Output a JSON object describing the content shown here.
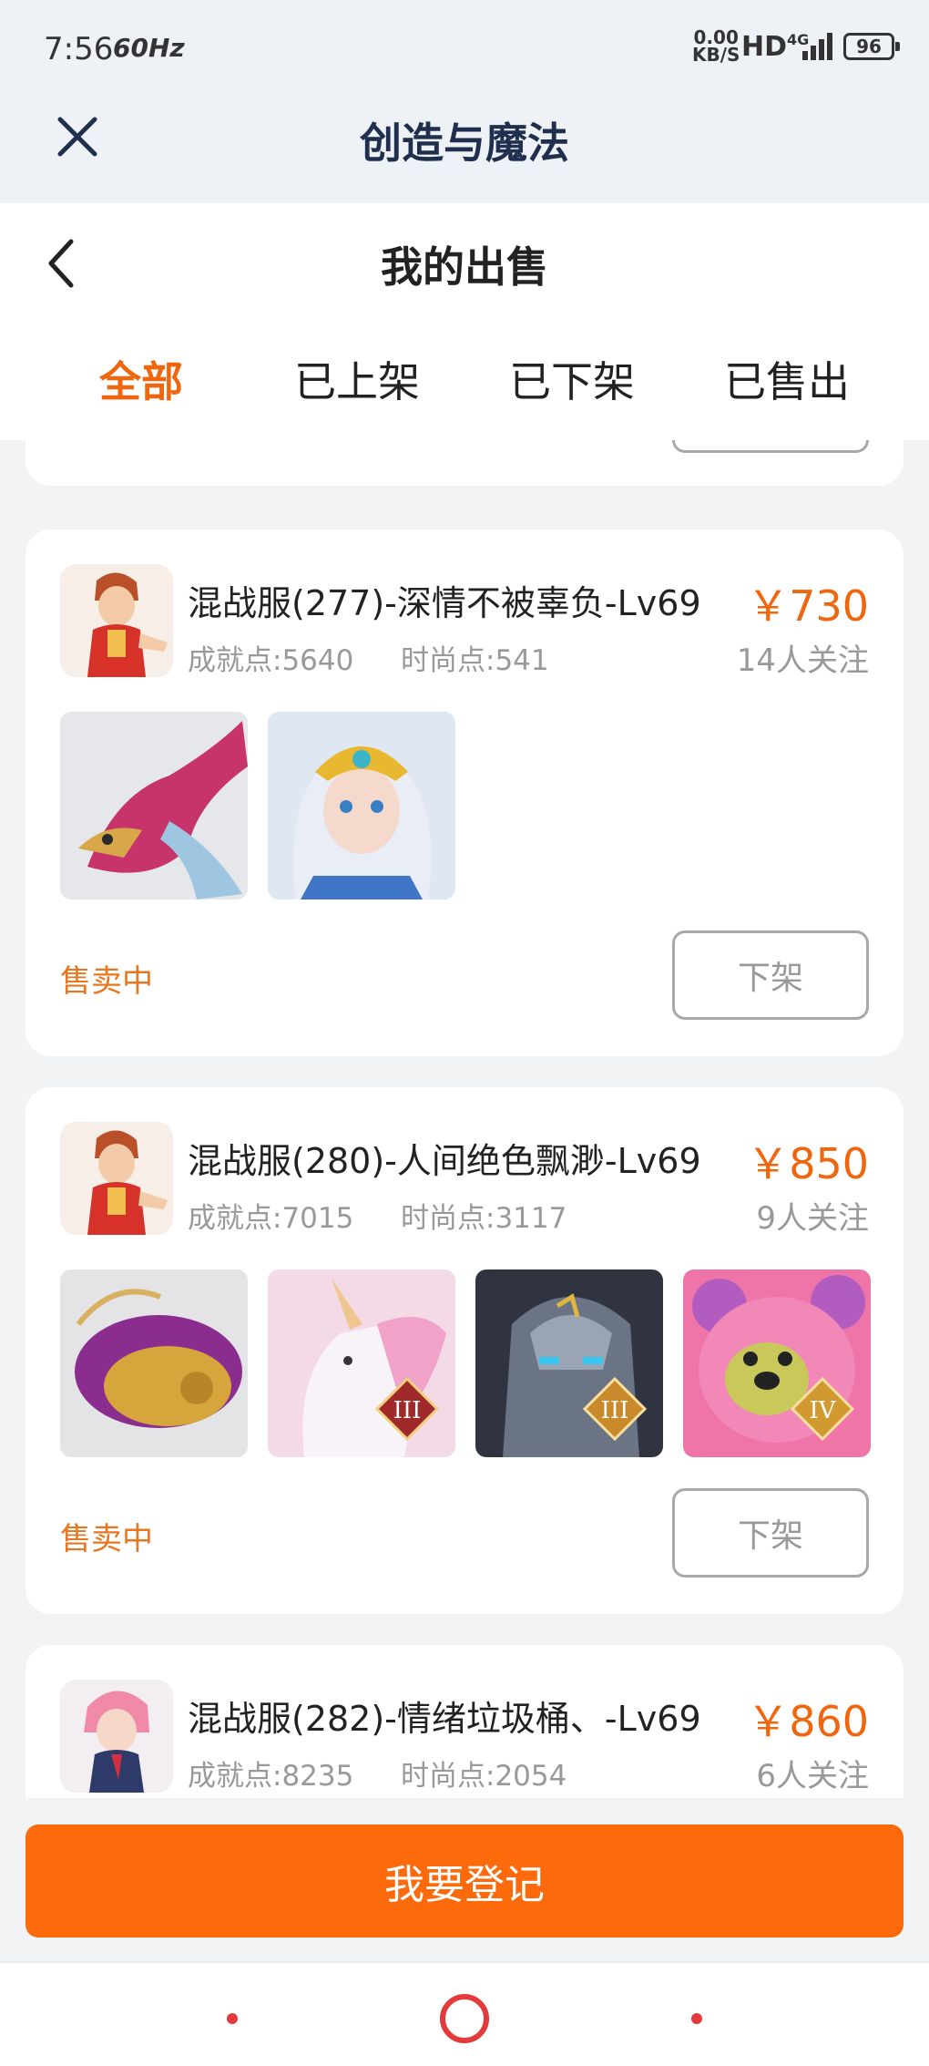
{
  "status_bar": {
    "time": "7:56",
    "refresh": "60Hz",
    "net_speed_value": "0.00",
    "net_speed_unit": "KB/S",
    "hd": "HD",
    "network": "4G",
    "battery": "96"
  },
  "app_bar": {
    "title": "创造与魔法",
    "close_icon": "close-icon"
  },
  "page": {
    "title": "我的出售",
    "back_icon": "chevron-left-icon"
  },
  "tabs": [
    {
      "label": "全部",
      "active": true
    },
    {
      "label": "已上架",
      "active": false
    },
    {
      "label": "已下架",
      "active": false
    },
    {
      "label": "已售出",
      "active": false
    }
  ],
  "listings": [
    {
      "title": "混战服(277)-深情不被辜负-Lv69",
      "achievement": "成就点:5640",
      "fashion": "时尚点:541",
      "price": "￥730",
      "followers": "14人关注",
      "status": "售卖中",
      "action": "下架",
      "thumbnails": [
        "dragon-mount-image",
        "golden-helmet-girl-image"
      ]
    },
    {
      "title": "混战服(280)-人间绝色飘渺-Lv69",
      "achievement": "成就点:7015",
      "fashion": "时尚点:3117",
      "price": "￥850",
      "followers": "9人关注",
      "status": "售卖中",
      "action": "下架",
      "thumbnails": [
        "purple-whale-image",
        "unicorn-image",
        "stone-golem-image",
        "pink-bear-image"
      ],
      "rank_badges": [
        "III",
        "III",
        "IV"
      ]
    },
    {
      "title": "混战服(282)-情绪垃圾桶、-Lv69",
      "achievement": "成就点:8235",
      "fashion": "时尚点:2054",
      "price": "￥860",
      "followers": "6人关注"
    }
  ],
  "register_button": "我要登记",
  "colors": {
    "accent": "#f0660f",
    "button": "#fc6a0c",
    "status": "#e8761f",
    "nav": "#e33b3b"
  }
}
